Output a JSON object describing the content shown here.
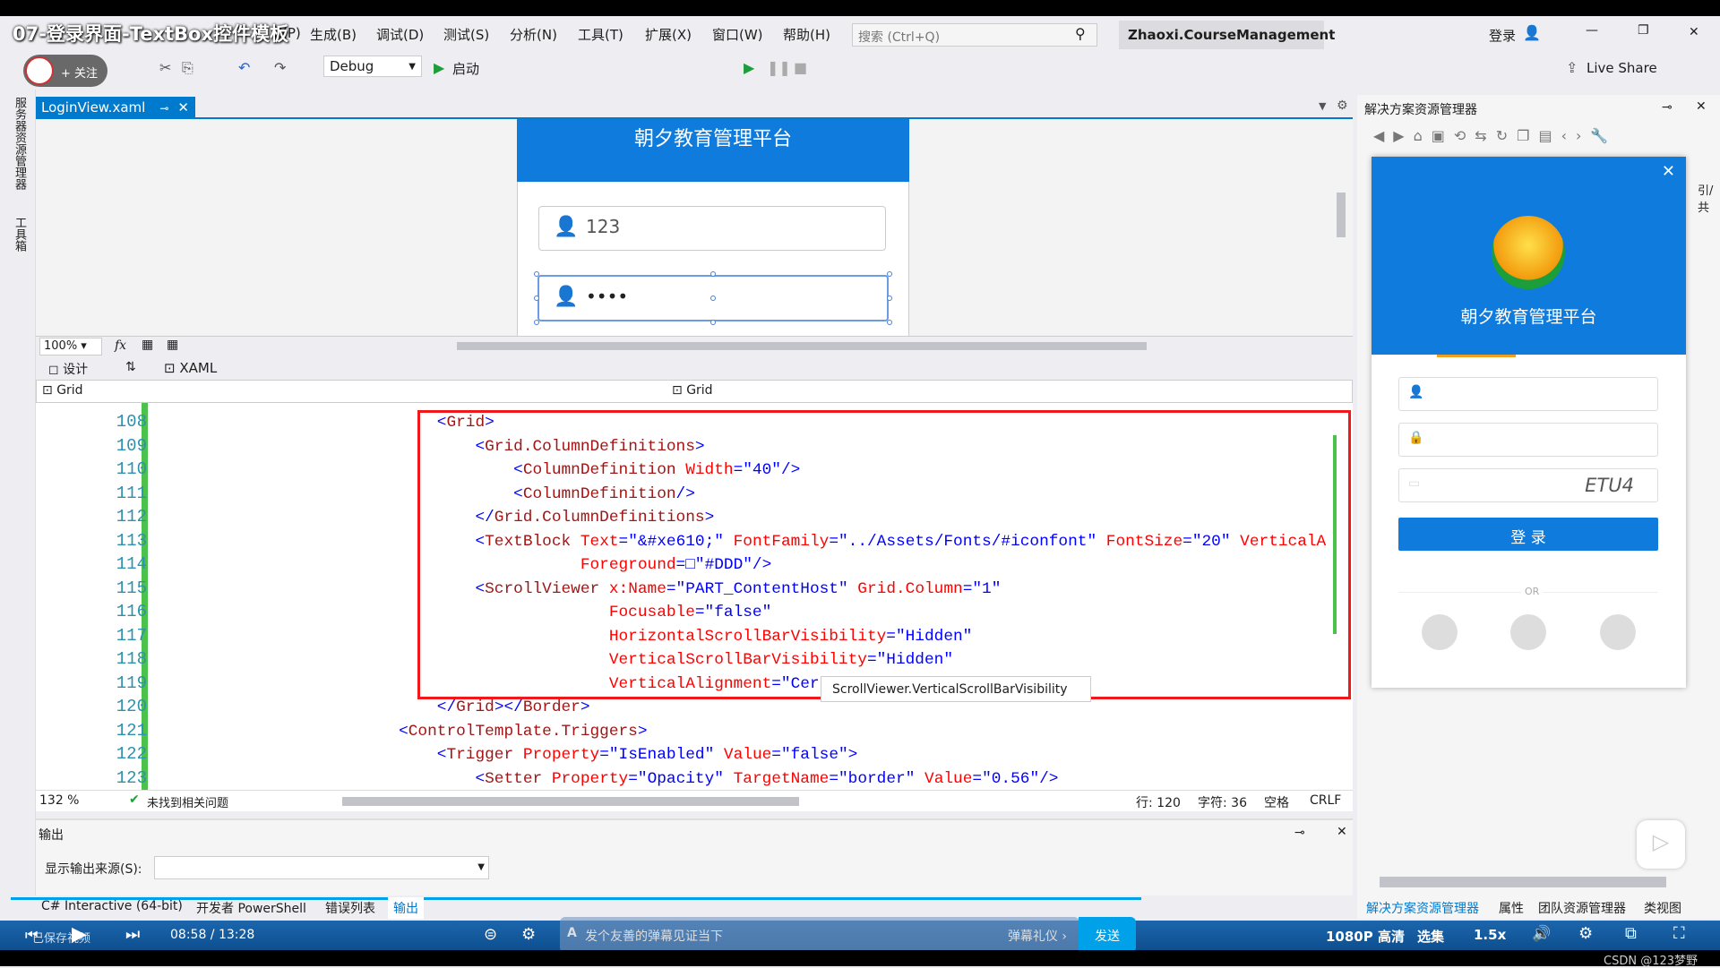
{
  "video_title": "07-登录界面-TextBox控件模板",
  "menu": [
    "…(P)",
    "生成(B)",
    "调试(D)",
    "测试(S)",
    "分析(N)",
    "工具(T)",
    "扩展(X)",
    "窗口(W)",
    "帮助(H)"
  ],
  "search_placeholder": "搜索 (Ctrl+Q)",
  "project_name": "Zhaoxi.CourseManagement",
  "login_label": "登录",
  "follow_label": "+ 关注",
  "config": "Debug",
  "start_label": "启动",
  "live_share": "Live Share",
  "doc_tab": "LoginView.xaml",
  "left_strip": [
    "服务器资源管理器",
    "工具箱"
  ],
  "designer": {
    "title": "朝夕教育管理平台",
    "username": "123",
    "password": "••••",
    "zoom": "100%"
  },
  "split": {
    "design": "设计",
    "xaml": "XAML"
  },
  "nav": {
    "left": "Grid",
    "right": "Grid"
  },
  "code_lines": [
    {
      "n": "108",
      "tokens": [
        {
          "c": "p",
          "t": "                            <"
        },
        {
          "c": "t",
          "t": "Grid"
        },
        {
          "c": "p",
          "t": ">"
        }
      ]
    },
    {
      "n": "109",
      "tokens": [
        {
          "c": "p",
          "t": "                                <"
        },
        {
          "c": "t",
          "t": "Grid.ColumnDefinitions"
        },
        {
          "c": "p",
          "t": ">"
        }
      ]
    },
    {
      "n": "110",
      "tokens": [
        {
          "c": "p",
          "t": "                                    <"
        },
        {
          "c": "t",
          "t": "ColumnDefinition"
        },
        {
          "c": "a",
          "t": " Width"
        },
        {
          "c": "p",
          "t": "=\""
        },
        {
          "c": "v",
          "t": "40"
        },
        {
          "c": "p",
          "t": "\"/>"
        }
      ]
    },
    {
      "n": "111",
      "tokens": [
        {
          "c": "p",
          "t": "                                    <"
        },
        {
          "c": "t",
          "t": "ColumnDefinition"
        },
        {
          "c": "p",
          "t": "/>"
        }
      ]
    },
    {
      "n": "112",
      "tokens": [
        {
          "c": "p",
          "t": "                                </"
        },
        {
          "c": "t",
          "t": "Grid.ColumnDefinitions"
        },
        {
          "c": "p",
          "t": ">"
        }
      ]
    },
    {
      "n": "113",
      "tokens": [
        {
          "c": "p",
          "t": "                                <"
        },
        {
          "c": "t",
          "t": "TextBlock"
        },
        {
          "c": "a",
          "t": " Text"
        },
        {
          "c": "p",
          "t": "=\""
        },
        {
          "c": "v",
          "t": "&#xe610;"
        },
        {
          "c": "p",
          "t": "\""
        },
        {
          "c": "a",
          "t": " FontFamily"
        },
        {
          "c": "p",
          "t": "=\""
        },
        {
          "c": "v",
          "t": "../Assets/Fonts/#iconfont"
        },
        {
          "c": "p",
          "t": "\""
        },
        {
          "c": "a",
          "t": " FontSize"
        },
        {
          "c": "p",
          "t": "=\""
        },
        {
          "c": "v",
          "t": "20"
        },
        {
          "c": "p",
          "t": "\""
        },
        {
          "c": "a",
          "t": " VerticalA"
        }
      ]
    },
    {
      "n": "114",
      "tokens": [
        {
          "c": "a",
          "t": "                                           Foreground"
        },
        {
          "c": "p",
          "t": "=□\""
        },
        {
          "c": "v",
          "t": "#DDD"
        },
        {
          "c": "p",
          "t": "\"/>"
        }
      ]
    },
    {
      "n": "115",
      "tokens": [
        {
          "c": "p",
          "t": "                                <"
        },
        {
          "c": "t",
          "t": "ScrollViewer"
        },
        {
          "c": "a",
          "t": " x:Name"
        },
        {
          "c": "p",
          "t": "=\""
        },
        {
          "c": "v",
          "t": "PART_ContentHost"
        },
        {
          "c": "p",
          "t": "\""
        },
        {
          "c": "a",
          "t": " Grid.Column"
        },
        {
          "c": "p",
          "t": "=\""
        },
        {
          "c": "v",
          "t": "1"
        },
        {
          "c": "p",
          "t": "\""
        }
      ]
    },
    {
      "n": "116",
      "tokens": [
        {
          "c": "a",
          "t": "                                              Focusable"
        },
        {
          "c": "p",
          "t": "=\""
        },
        {
          "c": "v",
          "t": "false"
        },
        {
          "c": "p",
          "t": "\""
        }
      ]
    },
    {
      "n": "117",
      "tokens": [
        {
          "c": "a",
          "t": "                                              HorizontalScrollBarVisibility"
        },
        {
          "c": "p",
          "t": "=\""
        },
        {
          "c": "v",
          "t": "Hidden"
        },
        {
          "c": "p",
          "t": "\""
        }
      ]
    },
    {
      "n": "118",
      "tokens": [
        {
          "c": "a",
          "t": "                                              VerticalScrollBarVisibility"
        },
        {
          "c": "p",
          "t": "=\""
        },
        {
          "c": "v",
          "t": "Hidden"
        },
        {
          "c": "p",
          "t": "\""
        }
      ]
    },
    {
      "n": "119",
      "tokens": [
        {
          "c": "a",
          "t": "                                              VerticalAlignment"
        },
        {
          "c": "p",
          "t": "=\""
        },
        {
          "c": "v",
          "t": "Cer"
        }
      ]
    },
    {
      "n": "120",
      "tokens": [
        {
          "c": "p",
          "t": "                            </"
        },
        {
          "c": "t",
          "t": "Grid"
        },
        {
          "c": "p",
          "t": "></"
        },
        {
          "c": "t",
          "t": "Border"
        },
        {
          "c": "p",
          "t": ">"
        }
      ]
    },
    {
      "n": "121",
      "tokens": [
        {
          "c": "p",
          "t": "                        <"
        },
        {
          "c": "t",
          "t": "ControlTemplate.Triggers"
        },
        {
          "c": "p",
          "t": ">"
        }
      ]
    },
    {
      "n": "122",
      "tokens": [
        {
          "c": "p",
          "t": "                            <"
        },
        {
          "c": "t",
          "t": "Trigger"
        },
        {
          "c": "a",
          "t": " Property"
        },
        {
          "c": "p",
          "t": "=\""
        },
        {
          "c": "v",
          "t": "IsEnabled"
        },
        {
          "c": "p",
          "t": "\""
        },
        {
          "c": "a",
          "t": " Value"
        },
        {
          "c": "p",
          "t": "=\""
        },
        {
          "c": "v",
          "t": "false"
        },
        {
          "c": "p",
          "t": "\">"
        }
      ]
    },
    {
      "n": "123",
      "tokens": [
        {
          "c": "p",
          "t": "                                <"
        },
        {
          "c": "t",
          "t": "Setter"
        },
        {
          "c": "a",
          "t": " Property"
        },
        {
          "c": "p",
          "t": "=\""
        },
        {
          "c": "v",
          "t": "Opacity"
        },
        {
          "c": "p",
          "t": "\""
        },
        {
          "c": "a",
          "t": " TargetName"
        },
        {
          "c": "p",
          "t": "=\""
        },
        {
          "c": "v",
          "t": "border"
        },
        {
          "c": "p",
          "t": "\""
        },
        {
          "c": "a",
          "t": " Value"
        },
        {
          "c": "p",
          "t": "=\""
        },
        {
          "c": "v",
          "t": "0.56"
        },
        {
          "c": "p",
          "t": "\"/>"
        }
      ]
    }
  ],
  "tooltip": "ScrollViewer.VerticalScrollBarVisibility",
  "status": {
    "zoom": "132 %",
    "issues": "未找到相关问题",
    "line": "行: 120",
    "char": "字符: 36",
    "space": "空格",
    "eol": "CRLF"
  },
  "output": {
    "title": "输出",
    "source_label": "显示输出来源(S):"
  },
  "bottom_tabs": [
    "C# Interactive (64-bit)",
    "开发者 PowerShell",
    "错误列表",
    "输出"
  ],
  "right": {
    "title": "解决方案资源管理器",
    "tabs": [
      "解决方案资源管理器",
      "属性",
      "团队资源管理器",
      "类视图"
    ],
    "side_text": "引/共"
  },
  "login_card": {
    "title": "朝夕教育管理平台",
    "captcha": "ETU4",
    "button": "登 录",
    "or": "OR"
  },
  "video": {
    "save_label": "已保存视频",
    "time": "08:58 / 13:28",
    "danmu_placeholder": "发个友善的弹幕见证当下",
    "gift": "弹幕礼仪 ›",
    "send": "发送",
    "quality": "1080P 高清",
    "episodes": "选集",
    "speed": "1.5x",
    "watermark": "CSDN @123梦野",
    "progress": 0.67
  },
  "colors": {
    "accent": "#007acc",
    "brand_blue": "#0f7bdc",
    "highlight_box": "#f01818"
  }
}
